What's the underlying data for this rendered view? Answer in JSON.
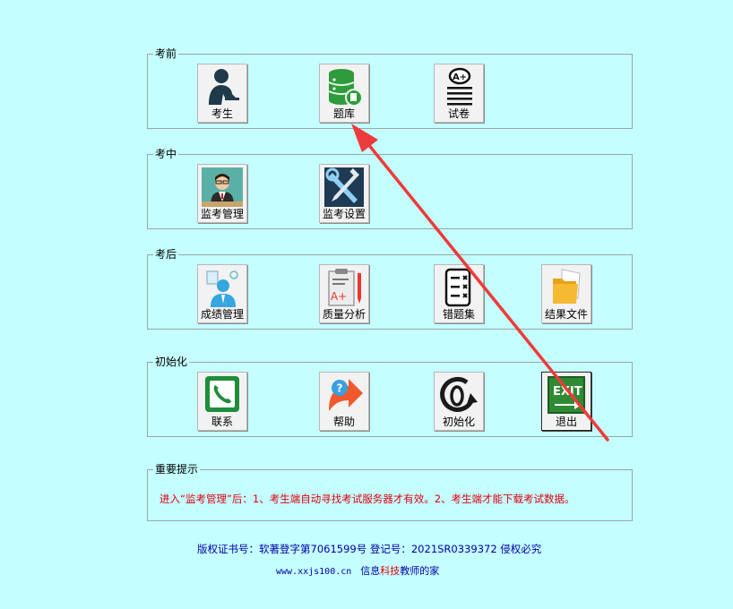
{
  "colors": {
    "background": "#c4fefe",
    "notice": "#e0000d",
    "footer": "#0000a8",
    "arrow": "#ee3b3b"
  },
  "groups": {
    "before": {
      "title": "考前",
      "items": [
        {
          "label": "考生",
          "icon": "student-icon"
        },
        {
          "label": "题库",
          "icon": "database-icon"
        },
        {
          "label": "试卷",
          "icon": "exam-paper-icon"
        }
      ]
    },
    "during": {
      "title": "考中",
      "items": [
        {
          "label": "监考管理",
          "icon": "proctor-icon"
        },
        {
          "label": "监考设置",
          "icon": "tools-icon"
        }
      ]
    },
    "after": {
      "title": "考后",
      "items": [
        {
          "label": "成绩管理",
          "icon": "score-user-icon"
        },
        {
          "label": "质量分析",
          "icon": "report-icon"
        },
        {
          "label": "错题集",
          "icon": "checklist-icon"
        },
        {
          "label": "结果文件",
          "icon": "folder-icon"
        }
      ]
    },
    "init": {
      "title": "初始化",
      "items": [
        {
          "label": "联系",
          "icon": "phone-icon"
        },
        {
          "label": "帮助",
          "icon": "help-icon"
        },
        {
          "label": "初始化",
          "icon": "reset-icon"
        },
        {
          "label": "退出",
          "icon": "exit-icon"
        }
      ]
    },
    "notice": {
      "title": "重要提示",
      "text": "进入“监考管理”后：1、考生端自动寻找考试服务器才有效。2、考生端才能下载考试数据。"
    }
  },
  "footer": {
    "copyright": "版权证书号：软著登字第7061599号 登记号：2021SR0339372   侵权必究",
    "site": "www.xxjs100.cn",
    "brand_pre": "信息",
    "brand_hl": "科技",
    "brand_post": "教师的家"
  }
}
